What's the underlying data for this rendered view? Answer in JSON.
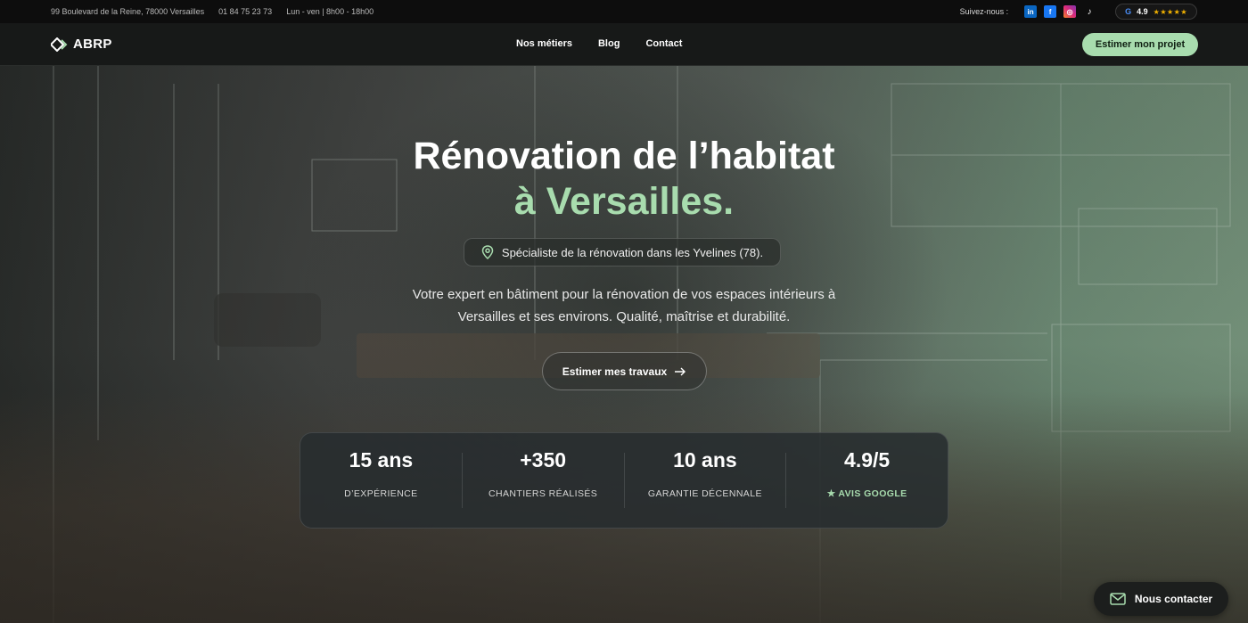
{
  "topbar": {
    "address": "99 Boulevard de la Reine, 78000 Versailles",
    "phone": "01 84 75 23 73",
    "hours": "Lun - ven | 8h00 - 18h00",
    "follow_label": "Suivez-nous :",
    "socials": [
      {
        "icon": "linkedin-icon",
        "glyph": "in"
      },
      {
        "icon": "facebook-icon",
        "glyph": "f"
      },
      {
        "icon": "instagram-icon",
        "glyph": "◎"
      },
      {
        "icon": "tiktok-icon",
        "glyph": "♪"
      }
    ],
    "google_rating": {
      "g": "G",
      "value": "4.9",
      "stars": "★★★★★"
    }
  },
  "nav": {
    "logo_text": "ABRP",
    "items": [
      "Nos métiers",
      "Blog",
      "Contact"
    ],
    "cta": "Estimer mon projet"
  },
  "hero": {
    "title_line1": "Rénovation de l’habitat",
    "title_line2": "à Versailles.",
    "tag": "Spécialiste de la rénovation dans les Yvelines (78).",
    "description_line1": "Votre expert en bâtiment pour la rénovation de vos espaces intérieurs à",
    "description_line2": "Versailles et ses environs. Qualité, maîtrise et durabilité.",
    "cta": "Estimer mes travaux"
  },
  "stats": [
    {
      "value": "15 ans",
      "label": "D’EXPÉRIENCE"
    },
    {
      "value": "+350",
      "label": "CHANTIERS RÉALISÉS"
    },
    {
      "value": "10 ans",
      "label": "GARANTIE DÉCENNALE"
    },
    {
      "value": "4.9/5",
      "label": "★  AVIS GOOGLE"
    }
  ],
  "floating_contact": "Nous contacter",
  "colors": {
    "accent": "#a8dcae",
    "dark": "#171918"
  }
}
